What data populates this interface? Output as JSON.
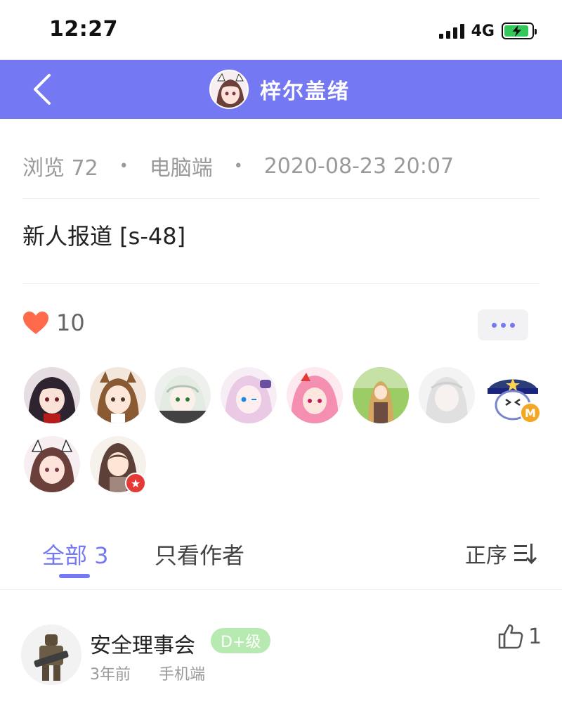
{
  "status_bar": {
    "time": "12:27",
    "network": "4G",
    "battery_percent": 90
  },
  "header": {
    "title": "梓尔盖绪",
    "back_icon": "chevron-left-icon"
  },
  "post": {
    "views": "浏览 72",
    "device": "电脑端",
    "datetime": "2020-08-23 20:07",
    "separator": "•",
    "content": "新人报道 [s-48]",
    "likes": "10",
    "like_icon": "heart-icon",
    "more_icon": "more-dots-icon"
  },
  "likers": [
    {
      "name": "dark-hair-girl-avatar"
    },
    {
      "name": "cat-ear-girl-avatar"
    },
    {
      "name": "white-hair-girl-avatar"
    },
    {
      "name": "pink-hair-girl-avatar"
    },
    {
      "name": "pink-twin-girl-avatar"
    },
    {
      "name": "blonde-knight-avatar"
    },
    {
      "name": "faded-character-avatar"
    },
    {
      "name": "police-hat-avatar",
      "badge": "M",
      "badge_color": "#f5a623"
    },
    {
      "name": "cat-maid-avatar"
    },
    {
      "name": "brown-hair-girl-avatar",
      "badge": "★",
      "badge_color": "#e53935"
    }
  ],
  "tabs": {
    "all": "全部 3",
    "author_only": "只看作者",
    "sort": "正序"
  },
  "comments": [
    {
      "user": "安全理事会",
      "level": "D+级",
      "time": "3年前",
      "device": "手机端",
      "likes": "1"
    }
  ],
  "colors": {
    "accent": "#7578f3",
    "heart": "#ff6b4a",
    "level_badge": "#b7eab0"
  }
}
